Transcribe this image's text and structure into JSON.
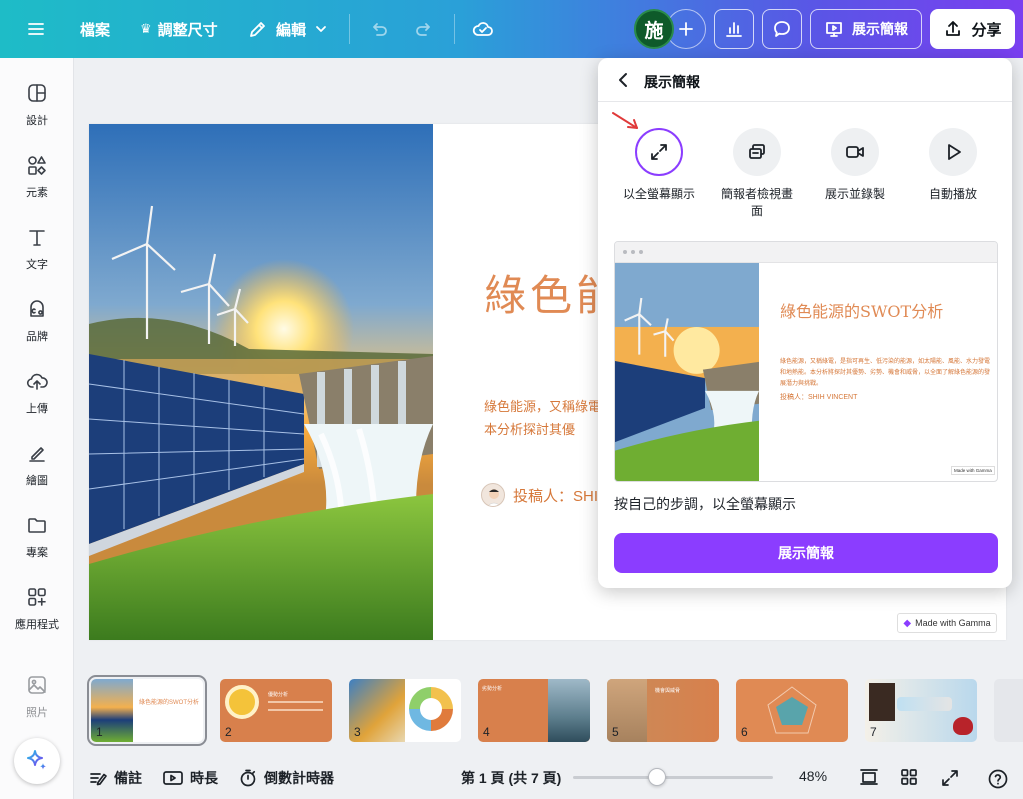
{
  "topbar": {
    "file_label": "檔案",
    "resize_label": "調整尺寸",
    "edit_label": "編輯",
    "avatar_initial": "施",
    "present_label": "展示簡報",
    "share_label": "分享"
  },
  "rail": [
    {
      "label": "設計",
      "icon": "layout-icon"
    },
    {
      "label": "元素",
      "icon": "shapes-icon"
    },
    {
      "label": "文字",
      "icon": "text-icon"
    },
    {
      "label": "品牌",
      "icon": "brand-icon"
    },
    {
      "label": "上傳",
      "icon": "upload-cloud-icon"
    },
    {
      "label": "繪圖",
      "icon": "draw-icon"
    },
    {
      "label": "專案",
      "icon": "folder-icon"
    },
    {
      "label": "應用程式",
      "icon": "apps-icon"
    },
    {
      "label": "照片",
      "icon": "photo-icon"
    }
  ],
  "slide": {
    "title": "綠色能",
    "body": "綠色能源，又稱綠電。本分析探討其優",
    "author": "投稿人：SHI",
    "badge": "Made with Gamma"
  },
  "panel": {
    "title": "展示簡報",
    "options": [
      {
        "label": "以全螢幕顯示",
        "icon": "expand-icon"
      },
      {
        "label": "簡報者檢視畫面",
        "icon": "presenter-view-icon"
      },
      {
        "label": "展示並錄製",
        "icon": "video-camera-icon"
      },
      {
        "label": "自動播放",
        "icon": "play-icon"
      }
    ],
    "preview": {
      "title": "綠色能源的SWOT分析",
      "body": "綠色能源，又稱綠電，是指可再生、低污染的能源，如太陽能、風能、水力發電和地熱能。本分析將探討其優勢、劣勢、機會和威脅，以全面了解綠色能源的發展潛力與挑戰。",
      "author": "投稿人：SHIH VINCENT",
      "badge": "Made with Gamma"
    },
    "description": "按自己的步調，以全螢幕顯示",
    "cta_label": "展示簡報"
  },
  "thumbnails": [
    {
      "num": "1",
      "text": "綠色能源的SWOT分析"
    },
    {
      "num": "2",
      "text": "優勢分析"
    },
    {
      "num": "3",
      "text": ""
    },
    {
      "num": "4",
      "text": "劣勢分析"
    },
    {
      "num": "5",
      "text": "機會與威脅"
    },
    {
      "num": "6",
      "text": ""
    },
    {
      "num": "7",
      "text": ""
    }
  ],
  "bottom": {
    "notes_label": "備註",
    "duration_label": "時長",
    "timer_label": "倒數計時器",
    "page_label": "第 1 頁 (共 7 頁)",
    "zoom_label": "48%",
    "zoom_value": 48
  },
  "colors": {
    "accent": "#8b3dff",
    "slide_text": "#e08a54"
  }
}
